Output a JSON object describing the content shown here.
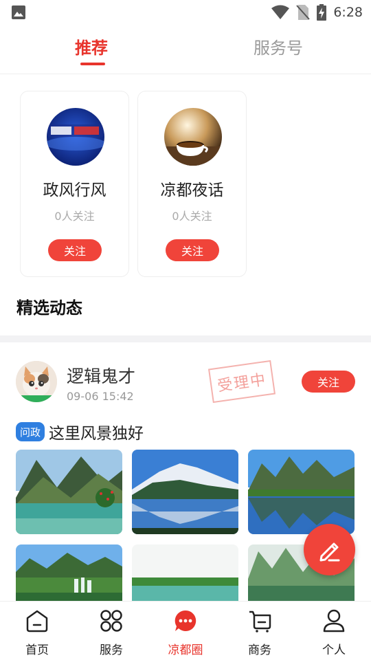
{
  "status_bar": {
    "time": "6:28"
  },
  "tabs": [
    {
      "label": "推荐",
      "active": true
    },
    {
      "label": "服务号",
      "active": false
    }
  ],
  "recommend_cards": [
    {
      "name": "政风行风",
      "followers": "0人关注",
      "follow_label": "关注"
    },
    {
      "name": "凉都夜话",
      "followers": "0人关注",
      "follow_label": "关注"
    }
  ],
  "section_title": "精选动态",
  "post": {
    "user": "逻辑鬼才",
    "time": "09-06 15:42",
    "stamp": "受理中",
    "follow_label": "关注",
    "tag": "问政",
    "text": "这里风景独好"
  },
  "bottom_nav": [
    {
      "label": "首页",
      "icon": "home-icon"
    },
    {
      "label": "服务",
      "icon": "grid-icon"
    },
    {
      "label": "凉都圈",
      "icon": "chat-bubble-icon",
      "active": true
    },
    {
      "label": "商务",
      "icon": "cart-icon"
    },
    {
      "label": "个人",
      "icon": "person-icon"
    }
  ],
  "colors": {
    "accent": "#e8342c",
    "tag": "#2f7fe0",
    "muted": "#999999"
  }
}
